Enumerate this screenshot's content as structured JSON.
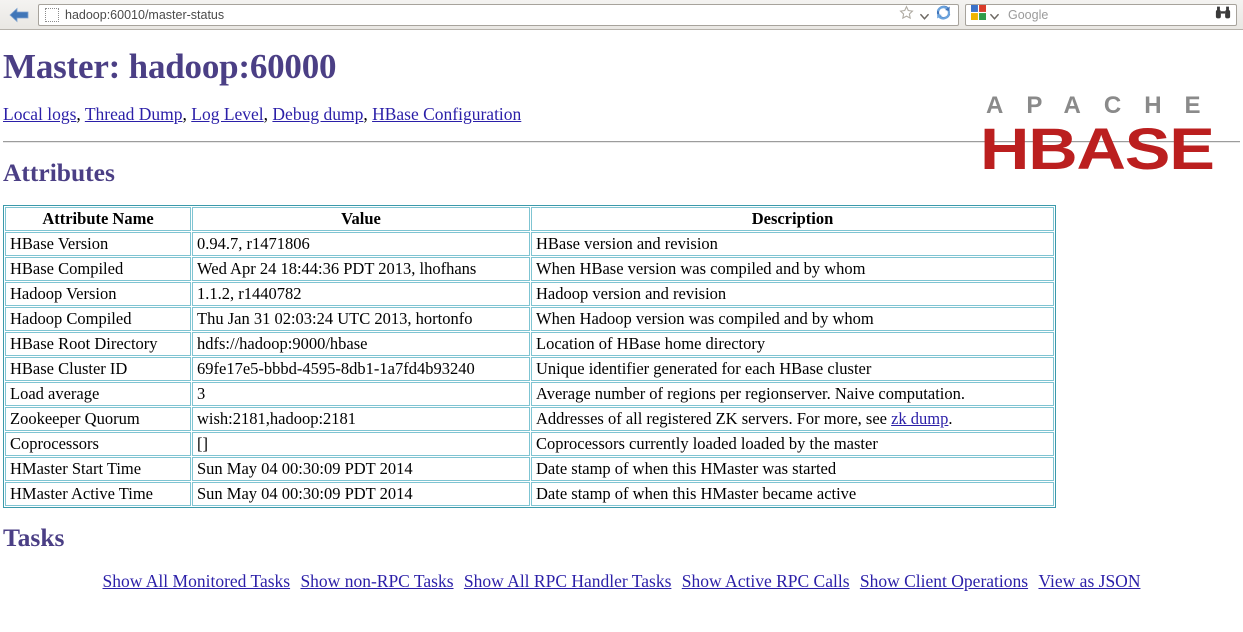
{
  "browser": {
    "back_tooltip": "Back",
    "url_scheme_host": "hadoop",
    "url_rest": ":60010/master-status",
    "url_full": "hadoop:60010/master-status",
    "search_placeholder": "Google",
    "icons": {
      "back": "back-arrow-icon",
      "favicon_placeholder": "favicon-placeholder-icon",
      "bookmark_star": "star-icon",
      "reload": "reload-icon",
      "google": "google-icon",
      "binoculars": "binoculars-icon"
    }
  },
  "page": {
    "title": "Master: hadoop:60000",
    "logo": {
      "top_text": "APACHE",
      "main_text": "HBASE"
    },
    "top_links": [
      {
        "label": "Local logs"
      },
      {
        "label": "Thread Dump"
      },
      {
        "label": "Log Level"
      },
      {
        "label": "Debug dump"
      },
      {
        "label": "HBase Configuration"
      }
    ],
    "link_separator": ", ",
    "attributes_heading": "Attributes",
    "tasks_heading": "Tasks"
  },
  "attributes_table": {
    "headers": [
      "Attribute Name",
      "Value",
      "Description"
    ],
    "rows": [
      {
        "name": "HBase Version",
        "value": "0.94.7, r1471806",
        "description": "HBase version and revision"
      },
      {
        "name": "HBase Compiled",
        "value": "Wed Apr 24 18:44:36 PDT 2013, lhofhans",
        "description": "When HBase version was compiled and by whom"
      },
      {
        "name": "Hadoop Version",
        "value": "1.1.2, r1440782",
        "description": "Hadoop version and revision"
      },
      {
        "name": "Hadoop Compiled",
        "value": "Thu Jan 31 02:03:24 UTC 2013, hortonfo",
        "description": "When Hadoop version was compiled and by whom"
      },
      {
        "name": "HBase Root Directory",
        "value": "hdfs://hadoop:9000/hbase",
        "description": "Location of HBase home directory"
      },
      {
        "name": "HBase Cluster ID",
        "value": "69fe17e5-bbbd-4595-8db1-1a7fd4b93240",
        "description": "Unique identifier generated for each HBase cluster"
      },
      {
        "name": "Load average",
        "value": "3",
        "description": "Average number of regions per regionserver. Naive computation."
      },
      {
        "name": "Zookeeper Quorum",
        "value": "wish:2181,hadoop:2181",
        "description_prefix": "Addresses of all registered ZK servers. For more, see ",
        "description_link": "zk dump",
        "description_suffix": "."
      },
      {
        "name": "Coprocessors",
        "value": "[]",
        "description": "Coprocessors currently loaded loaded by the master"
      },
      {
        "name": "HMaster Start Time",
        "value": "Sun May 04 00:30:09 PDT 2014",
        "description": "Date stamp of when this HMaster was started"
      },
      {
        "name": "HMaster Active Time",
        "value": "Sun May 04 00:30:09 PDT 2014",
        "description": "Date stamp of when this HMaster became active"
      }
    ]
  },
  "task_links": [
    {
      "label": "Show All Monitored Tasks"
    },
    {
      "label": "Show non-RPC Tasks"
    },
    {
      "label": "Show All RPC Handler Tasks"
    },
    {
      "label": "Show Active RPC Calls"
    },
    {
      "label": "Show Client Operations"
    },
    {
      "label": "View as JSON"
    }
  ],
  "colors": {
    "heading_purple": "#4b3f85",
    "link_blue": "#2b1fa8",
    "table_border": "#7fc4d2",
    "table_outer_border": "#3c9aab",
    "logo_red": "#bb1f1f",
    "logo_gray": "#8a8a8a"
  }
}
